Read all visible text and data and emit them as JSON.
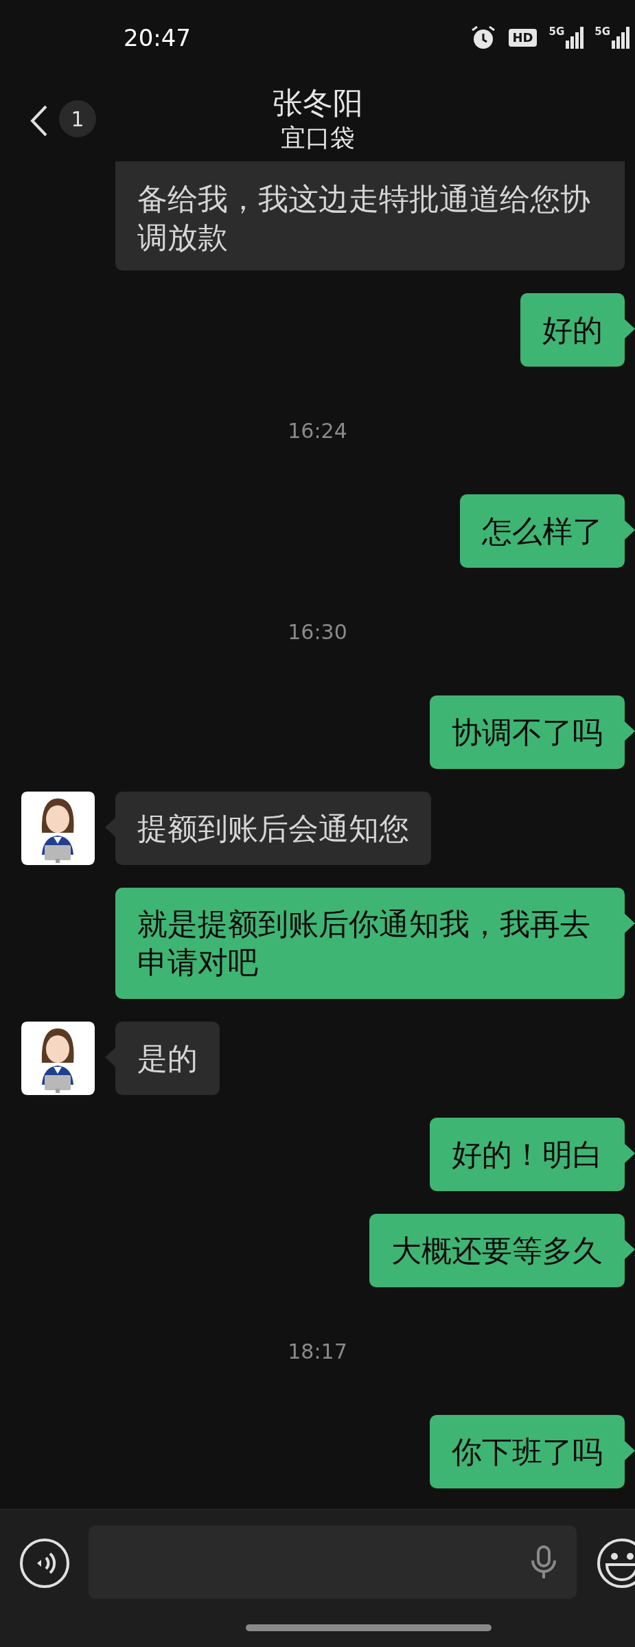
{
  "status_bar": {
    "time": "20:47",
    "hd_label": "HD",
    "networks": [
      "5G",
      "5G"
    ]
  },
  "header": {
    "unread_count": "1",
    "title": "张冬阳",
    "subtitle": "宜口袋"
  },
  "messages": [
    {
      "kind": "received",
      "clipped": true,
      "text": "备给我，我这边走特批通道给您协调放款"
    },
    {
      "kind": "sent",
      "text": "好的"
    },
    {
      "kind": "time",
      "text": "16:24"
    },
    {
      "kind": "sent",
      "text": "怎么样了"
    },
    {
      "kind": "time",
      "text": "16:30"
    },
    {
      "kind": "sent",
      "text": "协调不了吗"
    },
    {
      "kind": "received",
      "text": "提额到账后会通知您"
    },
    {
      "kind": "sent",
      "text": "就是提额到账后你通知我，我再去申请对吧"
    },
    {
      "kind": "received",
      "text": "是的"
    },
    {
      "kind": "sent",
      "text": "好的！明白"
    },
    {
      "kind": "sent",
      "text": "大概还要等多久"
    },
    {
      "kind": "time",
      "text": "18:17"
    },
    {
      "kind": "sent",
      "text": "你下班了吗"
    }
  ]
}
